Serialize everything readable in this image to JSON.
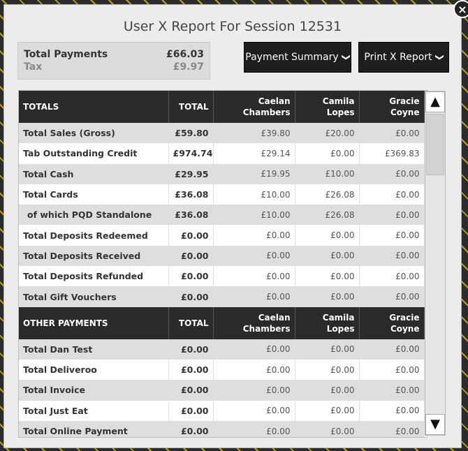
{
  "dialog": {
    "title": "User X Report For Session 12531",
    "close_icon": "×"
  },
  "summary": {
    "payments_label": "Total Payments",
    "payments_value": "£66.03",
    "tax_label": "Tax",
    "tax_value": "£9.97"
  },
  "buttons": {
    "payment_summary": "Payment Summary",
    "print_report": "Print X Report",
    "chevron": "❯"
  },
  "scroll": {
    "up": "▲",
    "down": "▼"
  },
  "sections": [
    {
      "headers": [
        "TOTALS",
        "TOTAL",
        "Caelan Chambers",
        "Camila Lopes",
        "Gracie Coyne"
      ],
      "rows": [
        [
          "Total Sales (Gross)",
          "£59.80",
          "£39.80",
          "£20.00",
          "£0.00"
        ],
        [
          "Tab Outstanding Credit",
          "£974.74",
          "£29.14",
          "£0.00",
          "£369.83"
        ],
        [
          "Total Cash",
          "£29.95",
          "£19.95",
          "£10.00",
          "£0.00"
        ],
        [
          "Total Cards",
          "£36.08",
          "£10.00",
          "£26.08",
          "£0.00"
        ],
        [
          "of which PQD Standalone",
          "£36.08",
          "£10.00",
          "£26.08",
          "£0.00"
        ],
        [
          "Total Deposits Redeemed",
          "£0.00",
          "£0.00",
          "£0.00",
          "£0.00"
        ],
        [
          "Total Deposits Received",
          "£0.00",
          "£0.00",
          "£0.00",
          "£0.00"
        ],
        [
          "Total Deposits Refunded",
          "£0.00",
          "£0.00",
          "£0.00",
          "£0.00"
        ],
        [
          "Total Gift Vouchers",
          "£0.00",
          "£0.00",
          "£0.00",
          "£0.00"
        ]
      ]
    },
    {
      "headers": [
        "OTHER PAYMENTS",
        "TOTAL",
        "Caelan Chambers",
        "Camila Lopes",
        "Gracie Coyne"
      ],
      "rows": [
        [
          "Total Dan Test",
          "£0.00",
          "£0.00",
          "£0.00",
          "£0.00"
        ],
        [
          "Total Deliveroo",
          "£0.00",
          "£0.00",
          "£0.00",
          "£0.00"
        ],
        [
          "Total Invoice",
          "£0.00",
          "£0.00",
          "£0.00",
          "£0.00"
        ],
        [
          "Total Just Eat",
          "£0.00",
          "£0.00",
          "£0.00",
          "£0.00"
        ],
        [
          "Total Online Payment",
          "£0.00",
          "£0.00",
          "£0.00",
          "£0.00"
        ]
      ]
    }
  ]
}
